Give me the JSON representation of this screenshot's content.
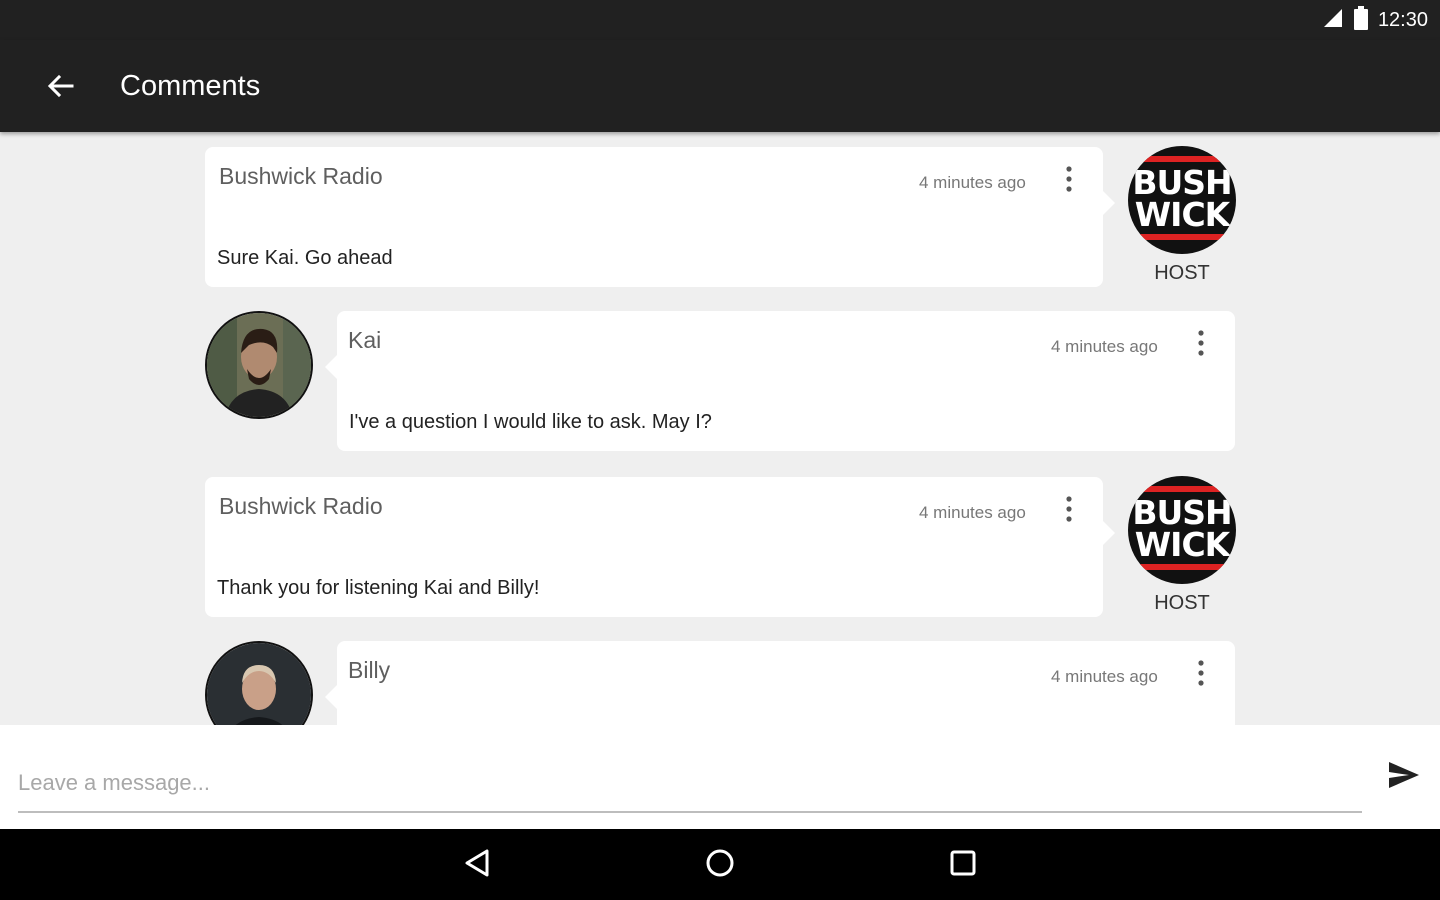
{
  "status_bar": {
    "time": "12:30",
    "signal_icon": "cell-signal-icon",
    "battery_icon": "battery-icon"
  },
  "app_bar": {
    "title": "Comments",
    "back_icon": "arrow-back-icon"
  },
  "comments": [
    {
      "author": "Bushwick Radio",
      "time": "4 minutes ago",
      "text": "Sure Kai. Go ahead",
      "role": "HOST"
    },
    {
      "author": "Kai",
      "time": "4 minutes ago",
      "text": "I've a question I would like to ask. May I?"
    },
    {
      "author": "Bushwick Radio",
      "time": "4 minutes ago",
      "text": "Thank you for listening Kai and Billy!",
      "role": "HOST"
    },
    {
      "author": "Billy",
      "time": "4 minutes ago",
      "text": ""
    }
  ],
  "host_logo": {
    "line1": "BUSH",
    "line2": "WICK"
  },
  "composer": {
    "placeholder": "Leave a message...",
    "value": "",
    "send_icon": "send-icon"
  },
  "nav": {
    "back_icon": "triangle-back-icon",
    "home_icon": "circle-home-icon",
    "recents_icon": "square-recents-icon"
  },
  "colors": {
    "bar": "#212121",
    "background": "#efefef",
    "logo_red": "#d22222"
  }
}
